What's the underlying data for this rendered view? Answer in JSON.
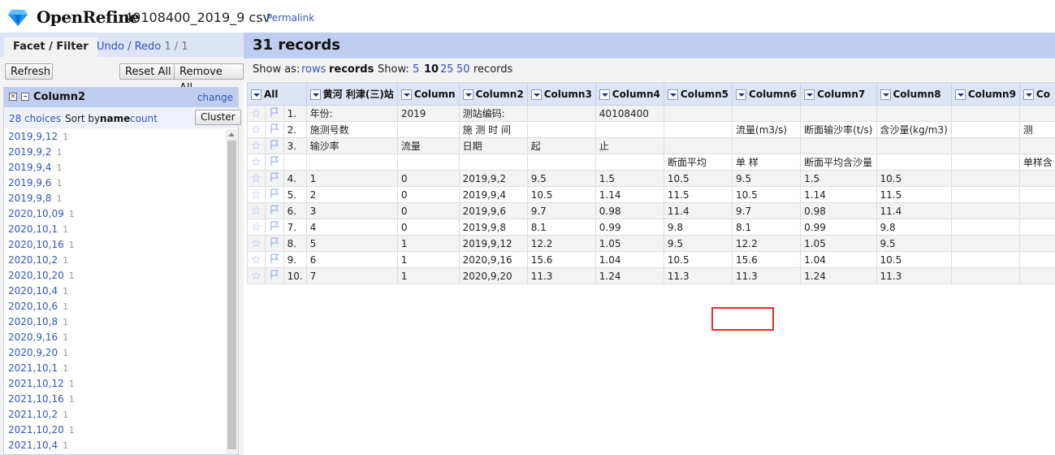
{
  "header": {
    "app_name": "OpenRefine",
    "project_name": "40108400_2019_9 csv",
    "permalink": "Permalink"
  },
  "left_panel": {
    "tabs": {
      "facet": "Facet / Filter",
      "undo": "Undo / Redo",
      "undo_count": "1 / 1"
    },
    "buttons": {
      "refresh": "Refresh",
      "reset_all": "Reset All",
      "remove_all": "Remove All"
    },
    "facet": {
      "name": "Column2",
      "change": "change",
      "choices": "28 choices",
      "sort_by": "Sort by:",
      "sort_name": "name",
      "sort_count": "count",
      "cluster": "Cluster",
      "items": [
        {
          "value": "2019,9,12",
          "count": "1"
        },
        {
          "value": "2019,9,2",
          "count": "1"
        },
        {
          "value": "2019,9,4",
          "count": "1"
        },
        {
          "value": "2019,9,6",
          "count": "1"
        },
        {
          "value": "2019,9,8",
          "count": "1"
        },
        {
          "value": "2020,10,09",
          "count": "1"
        },
        {
          "value": "2020,10,1",
          "count": "1"
        },
        {
          "value": "2020,10,16",
          "count": "1"
        },
        {
          "value": "2020,10,2",
          "count": "1"
        },
        {
          "value": "2020,10,20",
          "count": "1"
        },
        {
          "value": "2020,10,4",
          "count": "1"
        },
        {
          "value": "2020,10,6",
          "count": "1"
        },
        {
          "value": "2020,10,8",
          "count": "1"
        },
        {
          "value": "2020,9,16",
          "count": "1"
        },
        {
          "value": "2020,9,20",
          "count": "1"
        },
        {
          "value": "2021,10,1",
          "count": "1"
        },
        {
          "value": "2021,10,12",
          "count": "1"
        },
        {
          "value": "2021,10,16",
          "count": "1"
        },
        {
          "value": "2021,10,2",
          "count": "1"
        },
        {
          "value": "2021,10,20",
          "count": "1"
        },
        {
          "value": "2021,10,4",
          "count": "1"
        }
      ]
    }
  },
  "main": {
    "record_count": "31 records",
    "view": {
      "show_as": "Show as:",
      "rows": "rows",
      "records": "records",
      "show": "Show:",
      "sizes": [
        "5",
        "10",
        "25",
        "50"
      ],
      "unit": "records"
    },
    "columns": [
      "All",
      "黄河 利津(三)站",
      "Column",
      "Column2",
      "Column3",
      "Column4",
      "Column5",
      "Column6",
      "Column7",
      "Column8",
      "Column9",
      "Co"
    ],
    "rows": [
      {
        "idx": "1.",
        "cells": [
          "年份:",
          "2019",
          "测站编码:",
          "",
          "40108400",
          "",
          "",
          "",
          "",
          "",
          ""
        ]
      },
      {
        "idx": "2.",
        "cells": [
          "施测号数",
          "",
          "施 测 时 间",
          "",
          "",
          "",
          "流量(m3/s)",
          "断面输沙率(t/s)",
          "含沙量(kg/m3)",
          "",
          "测"
        ]
      },
      {
        "idx": "3.",
        "cells": [
          "输沙率",
          "流量",
          "日期",
          "起",
          "止",
          "",
          "",
          "",
          "",
          "",
          ""
        ]
      },
      {
        "idx": "",
        "cells": [
          "",
          "",
          "",
          "",
          "",
          "断面平均",
          "单 样",
          "断面平均含沙量",
          "",
          "",
          "单样含"
        ]
      },
      {
        "idx": "4.",
        "cells": [
          "1",
          "0",
          "2019,9,2",
          "9.5",
          "1.5",
          "10.5",
          "9.5",
          "1.5",
          "10.5",
          "",
          ""
        ]
      },
      {
        "idx": "5.",
        "cells": [
          "2",
          "0",
          "2019,9,4",
          "10.5",
          "1.14",
          "11.5",
          "10.5",
          "1.14",
          "11.5",
          "",
          ""
        ]
      },
      {
        "idx": "6.",
        "cells": [
          "3",
          "0",
          "2019,9,6",
          "9.7",
          "0.98",
          "11.4",
          "9.7",
          "0.98",
          "11.4",
          "",
          ""
        ]
      },
      {
        "idx": "7.",
        "cells": [
          "4",
          "0",
          "2019,9,8",
          "8.1",
          "0.99",
          "9.8",
          "8.1",
          "0.99",
          "9.8",
          "",
          ""
        ]
      },
      {
        "idx": "8.",
        "cells": [
          "5",
          "1",
          "2019,9,12",
          "12.2",
          "1.05",
          "9.5",
          "12.2",
          "1.05",
          "9.5",
          "",
          ""
        ]
      },
      {
        "idx": "9.",
        "cells": [
          "6",
          "1",
          "2020,9,16",
          "15.6",
          "1.04",
          "10.5",
          "15.6",
          "1.04",
          "10.5",
          "",
          ""
        ]
      },
      {
        "idx": "10.",
        "cells": [
          "7",
          "1",
          "2020,9,20",
          "11.3",
          "1.24",
          "11.3",
          "11.3",
          "1.24",
          "11.3",
          "",
          ""
        ]
      }
    ]
  },
  "colors": {
    "accent": "#3355bb",
    "header_bg": "#bfcdf0",
    "highlight": "#e0302b"
  }
}
